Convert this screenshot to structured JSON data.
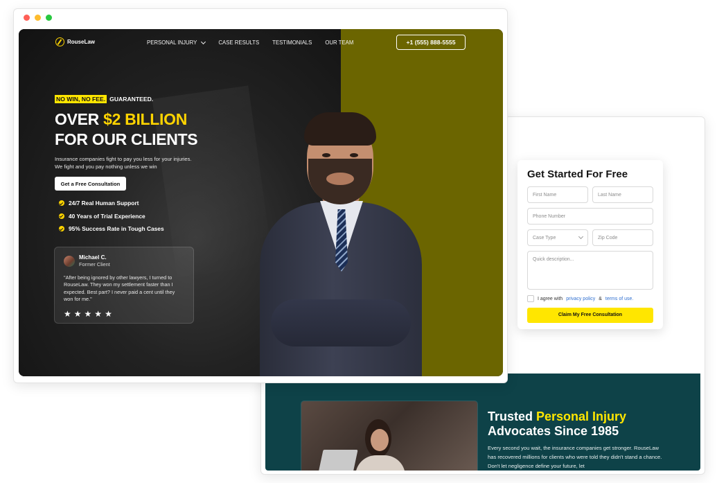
{
  "window_controls": [
    "close",
    "minimize",
    "maximize"
  ],
  "colors": {
    "accent": "#ffe600",
    "gold": "#ffd400",
    "teal": "#0e4248",
    "olive": "#6b6500"
  },
  "nav": {
    "logo": "RouseLaw",
    "items": [
      "PERSONAL INJURY",
      "CASE RESULTS",
      "TESTIMONIALS",
      "OUR TEAM"
    ],
    "phone": "+1 (555) 888-5555"
  },
  "hero": {
    "tag_highlight": "NO WIN, NO FEE.",
    "tag_rest": "GUARANTEED.",
    "headline_pre": "OVER ",
    "headline_amount": "$2 BILLION",
    "headline_line2": "FOR OUR CLIENTS",
    "subcopy": "Insurance companies fight to pay you less for your injuries. We fight and you pay nothing unless we win",
    "cta": "Get a Free Consultation",
    "features": [
      "24/7 Real Human Support",
      "40 Years of Trial Experience",
      "95% Success Rate in Tough Cases"
    ]
  },
  "testimonial": {
    "name": "Michael C.",
    "role": "Former Client",
    "quote": "\"After being ignored by other lawyers, I turned to RouseLaw. They won my settlement faster than I expected. Best part? I never paid a cent until they won for me.\"",
    "rating": 5,
    "stars": [
      "★",
      "★",
      "★",
      "★",
      "★"
    ]
  },
  "form": {
    "title": "Get Started For Free",
    "first_name_placeholder": "First Name",
    "last_name_placeholder": "Last Name",
    "phone_placeholder": "Phone Number",
    "case_type_placeholder": "Case Type",
    "zip_placeholder": "Zip Code",
    "description_placeholder": "Quick description...",
    "agree_text": "I agree with",
    "privacy_link": "privacy policy",
    "amp": "&",
    "terms_link": "terms of use.",
    "submit": "Claim My Free Consultation"
  },
  "about": {
    "title_pre": "Trusted ",
    "title_highlight": "Personal Injury",
    "title_line2": "Advocates Since 1985",
    "body": "Every second you wait, the insurance companies get stronger. RouseLaw has recovered millions for clients who were told they didn't stand a chance. Don't let negligence define your future, let"
  }
}
